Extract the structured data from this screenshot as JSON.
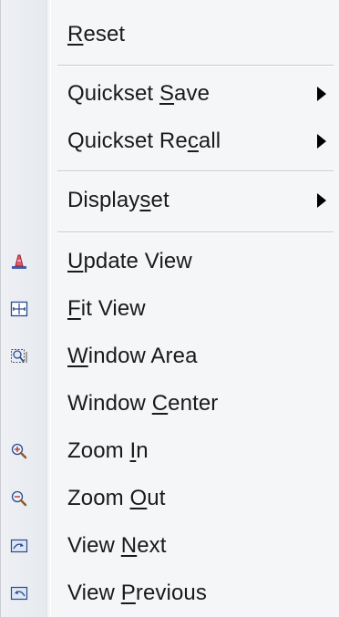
{
  "menu": {
    "items": [
      {
        "key": "reset",
        "pre": "",
        "ul": "R",
        "post": "eset",
        "submenu": false
      },
      {
        "key": "quickset-save",
        "pre": "Quickset ",
        "ul": "S",
        "post": "ave",
        "submenu": true
      },
      {
        "key": "quickset-recall",
        "pre": "Quickset Re",
        "ul": "c",
        "post": "all",
        "submenu": true
      },
      {
        "key": "displayset",
        "pre": "Display",
        "ul": "s",
        "post": "et",
        "submenu": true
      },
      {
        "key": "update-view",
        "pre": "",
        "ul": "U",
        "post": "pdate View",
        "submenu": false,
        "icon": "update-view-icon"
      },
      {
        "key": "fit-view",
        "pre": "",
        "ul": "F",
        "post": "it View",
        "submenu": false,
        "icon": "fit-view-icon"
      },
      {
        "key": "window-area",
        "pre": "",
        "ul": "W",
        "post": "indow Area",
        "submenu": false,
        "icon": "window-area-icon"
      },
      {
        "key": "window-center",
        "pre": "Window ",
        "ul": "C",
        "post": "enter",
        "submenu": false
      },
      {
        "key": "zoom-in",
        "pre": "Zoom ",
        "ul": "I",
        "post": "n",
        "submenu": false,
        "icon": "zoom-in-icon"
      },
      {
        "key": "zoom-out",
        "pre": "Zoom ",
        "ul": "O",
        "post": "ut",
        "submenu": false,
        "icon": "zoom-out-icon"
      },
      {
        "key": "view-next",
        "pre": "View ",
        "ul": "N",
        "post": "ext",
        "submenu": false,
        "icon": "view-next-icon"
      },
      {
        "key": "view-previous",
        "pre": "View ",
        "ul": "P",
        "post": "revious",
        "submenu": false,
        "icon": "view-previous-icon"
      }
    ]
  }
}
